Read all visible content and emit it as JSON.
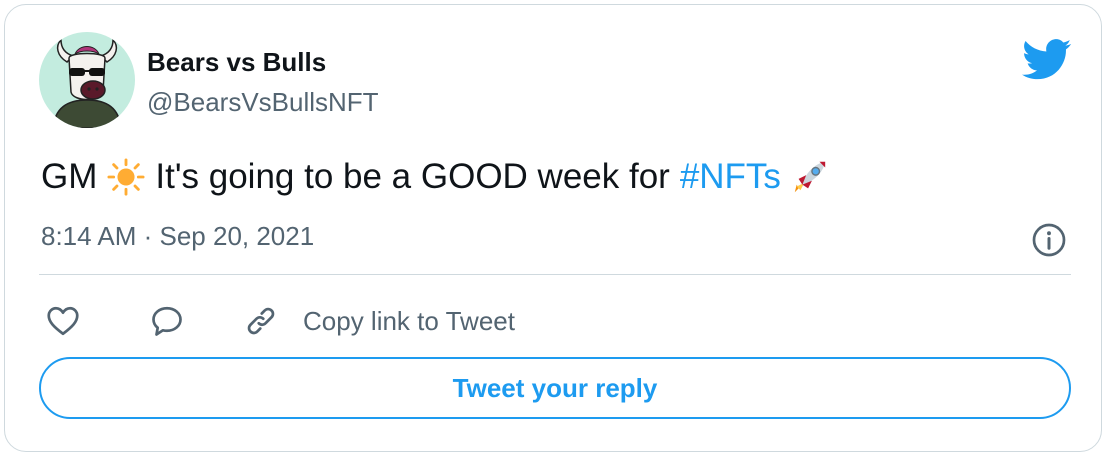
{
  "author": {
    "name": "Bears vs Bulls",
    "handle": "@BearsVsBullsNFT",
    "avatar_icon": "bull-avatar"
  },
  "tweet": {
    "text_before": "GM",
    "emoji_sun": "sun-emoji",
    "text_middle": "It's going to be a GOOD week for",
    "hashtag": "#NFTs",
    "emoji_rocket": "rocket-emoji",
    "timestamp": "8:14 AM · Sep 20, 2021"
  },
  "actions": {
    "like_icon": "heart-icon",
    "reply_icon": "reply-bubble-icon",
    "copy_icon": "link-icon",
    "copy_label": "Copy link to Tweet",
    "reply_button": "Tweet your reply"
  },
  "colors": {
    "accent": "#1d9bf0",
    "text": "#0f1419",
    "muted": "#536471",
    "border": "#cfd9de"
  }
}
